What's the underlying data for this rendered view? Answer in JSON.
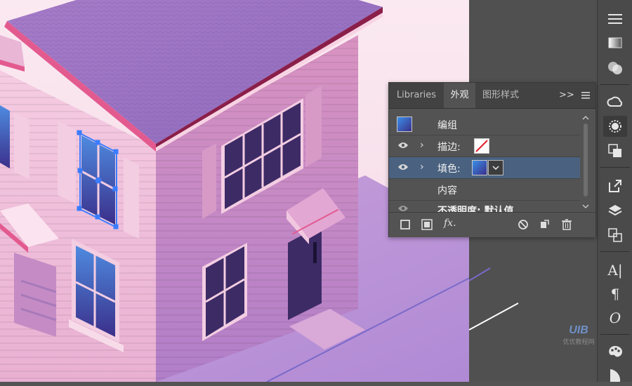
{
  "panel": {
    "tabs": [
      {
        "label": "Libraries"
      },
      {
        "label": "外观"
      },
      {
        "label": "图形样式"
      }
    ],
    "menu_icon": ">>",
    "rows": [
      {
        "label": "编组"
      },
      {
        "label": "描边:"
      },
      {
        "label": "填色:"
      },
      {
        "label": "内容"
      },
      {
        "label": "不透明度: 默认值"
      }
    ],
    "bottom": {
      "fx_label": "fx."
    }
  },
  "tools": [
    {
      "name": "menu-icon"
    },
    {
      "name": "gradient-icon"
    },
    {
      "name": "transparency-icon"
    },
    {
      "name": "creative-cloud-icon"
    },
    {
      "name": "appearance-icon"
    },
    {
      "name": "graphic-styles-icon"
    },
    {
      "name": "export-icon"
    },
    {
      "name": "layers-icon"
    },
    {
      "name": "artboards-icon"
    },
    {
      "name": "character-icon",
      "glyph": "A|"
    },
    {
      "name": "paragraph-icon",
      "glyph": "¶"
    },
    {
      "name": "opentype-icon",
      "glyph": "O"
    },
    {
      "name": "color-palette-icon"
    },
    {
      "name": "shape-icon"
    }
  ],
  "colors": {
    "roof": "#9a72c2",
    "wall_left": "#f2c3dc",
    "wall_right": "#e6a6c9",
    "window": "#3d2b66",
    "selection": "#3b7cff",
    "panel_bg": "#535353",
    "selected_row": "#4a6280"
  },
  "watermark": {
    "text": "优优教程网",
    "logo": "UIB"
  }
}
